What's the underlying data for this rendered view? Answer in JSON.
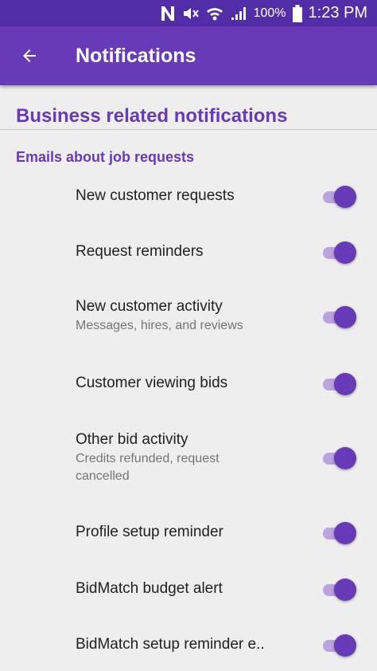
{
  "status_bar": {
    "carrier_icon": "n-badge-icon",
    "battery_percent": "100%",
    "time": "1:23 PM"
  },
  "app_bar": {
    "title": "Notifications",
    "back_icon": "arrow-back-icon"
  },
  "section": {
    "title": "Business related notifications",
    "subsection": "Emails about job requests"
  },
  "settings": [
    {
      "label": "New customer requests",
      "sub": "",
      "enabled": true
    },
    {
      "label": "Request reminders",
      "sub": "",
      "enabled": true
    },
    {
      "label": "New customer activity",
      "sub": "Messages, hires, and reviews",
      "enabled": true
    },
    {
      "label": "Customer viewing bids",
      "sub": "",
      "enabled": true
    },
    {
      "label": "Other bid activity",
      "sub": "Credits refunded, request cancelled",
      "enabled": true
    },
    {
      "label": "Profile setup reminder",
      "sub": "",
      "enabled": true
    },
    {
      "label": "BidMatch budget alert",
      "sub": "",
      "enabled": true
    },
    {
      "label": "BidMatch setup reminder e..",
      "sub": "",
      "enabled": true
    }
  ],
  "colors": {
    "primary": "#673ab7",
    "primary_dark": "#512da8",
    "switch_track": "#b9a2dd",
    "background": "#eeeeee"
  }
}
